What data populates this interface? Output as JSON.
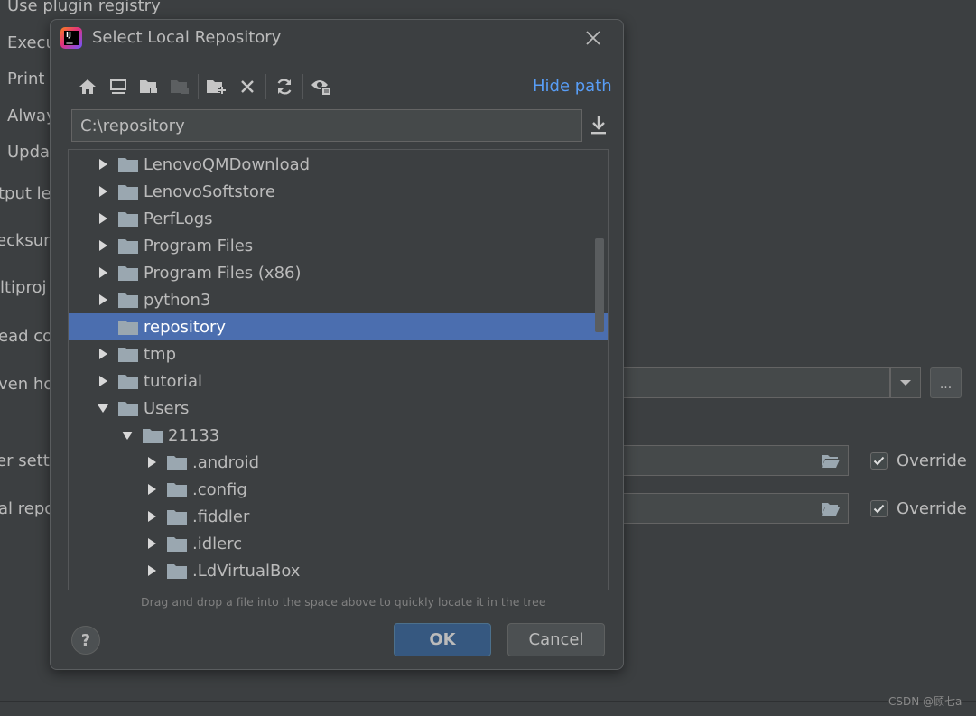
{
  "background": {
    "labels": [
      "Use plugin registry",
      "Execu",
      "Print",
      "Alway",
      "Upda",
      "tput le",
      "ecksum",
      "ltiproj",
      "ead co",
      "ven ho",
      "er settin",
      "al repo"
    ],
    "override_label_1": "Override",
    "override_label_2": "Override",
    "ellipsis_label": "...",
    "watermark": "CSDN @顾七a"
  },
  "dialog": {
    "title": "Select Local Repository",
    "hide_path_label": "Hide path",
    "path_value": "C:\\repository",
    "hint": "Drag and drop a file into the space above to quickly locate it in the tree",
    "ok_label": "OK",
    "cancel_label": "Cancel",
    "help_label": "?",
    "toolbar_icons": [
      "home-icon",
      "desktop-icon",
      "project-folder-icon",
      "module-folder-icon",
      "new-folder-icon",
      "delete-icon",
      "refresh-icon",
      "show-hidden-icon"
    ],
    "tree": [
      {
        "label": "LenovoQMDownload",
        "depth": 0,
        "arrow": "collapsed",
        "selected": false
      },
      {
        "label": "LenovoSoftstore",
        "depth": 0,
        "arrow": "collapsed",
        "selected": false
      },
      {
        "label": "PerfLogs",
        "depth": 0,
        "arrow": "collapsed",
        "selected": false
      },
      {
        "label": "Program Files",
        "depth": 0,
        "arrow": "collapsed",
        "selected": false
      },
      {
        "label": "Program Files (x86)",
        "depth": 0,
        "arrow": "collapsed",
        "selected": false
      },
      {
        "label": "python3",
        "depth": 0,
        "arrow": "collapsed",
        "selected": false
      },
      {
        "label": "repository",
        "depth": 0,
        "arrow": "none",
        "selected": true
      },
      {
        "label": "tmp",
        "depth": 0,
        "arrow": "collapsed",
        "selected": false
      },
      {
        "label": "tutorial",
        "depth": 0,
        "arrow": "collapsed",
        "selected": false
      },
      {
        "label": "Users",
        "depth": 0,
        "arrow": "expanded",
        "selected": false
      },
      {
        "label": "21133",
        "depth": 1,
        "arrow": "expanded",
        "selected": false
      },
      {
        "label": ".android",
        "depth": 2,
        "arrow": "collapsed",
        "selected": false
      },
      {
        "label": ".config",
        "depth": 2,
        "arrow": "collapsed",
        "selected": false
      },
      {
        "label": ".fiddler",
        "depth": 2,
        "arrow": "collapsed",
        "selected": false
      },
      {
        "label": ".idlerc",
        "depth": 2,
        "arrow": "collapsed",
        "selected": false
      },
      {
        "label": ".LdVirtualBox",
        "depth": 2,
        "arrow": "collapsed",
        "selected": false
      }
    ]
  },
  "colors": {
    "background": "#3c3f41",
    "selection": "#4b6eaf",
    "link": "#589df6",
    "primary_button": "#365880"
  }
}
